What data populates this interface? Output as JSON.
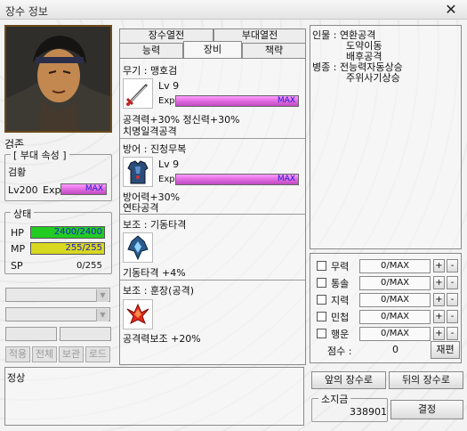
{
  "window": {
    "title": "장수 정보",
    "close_glyph": "✕"
  },
  "general": {
    "name": "검존",
    "unit_attr_title": "[ 부대 속성 ]",
    "unit_attr_value": "검황",
    "level_text": "Lv200",
    "exp_label": "Exp",
    "exp_max": "MAX",
    "exp_fraction": 1.0
  },
  "status": {
    "title": "상태",
    "hp": {
      "label": "HP",
      "value": "2400/2400",
      "fraction": 1.0,
      "color": "#22cc22"
    },
    "mp": {
      "label": "MP",
      "value": "255/255",
      "fraction": 1.0,
      "color": "#d8d820"
    },
    "sp": {
      "label": "SP",
      "value": "0/255",
      "fraction": 0.0,
      "color": "#888888"
    }
  },
  "left_buttons": [
    "적용",
    "전체",
    "보관",
    "로드"
  ],
  "top_tabs": [
    "장수열전",
    "부대열전"
  ],
  "sub_tabs": [
    "능력",
    "장비",
    "책략"
  ],
  "active_sub_tab": "장비",
  "equipment": {
    "weapon": {
      "header": "무기 : 맹호검",
      "level": "Lv 9",
      "exp_label": "Exp",
      "exp_max": "MAX",
      "exp_fraction": 1.0,
      "effect1": "공격력+30% 정신력+30%",
      "effect2": "치명일격공격"
    },
    "armor": {
      "header": "방어 : 진청무복",
      "level": "Lv 9",
      "exp_label": "Exp",
      "exp_max": "MAX",
      "exp_fraction": 1.0,
      "effect1": "방어력+30%",
      "effect2": "연타공격"
    },
    "aux1": {
      "header": "보조 : 기동타격",
      "effect1": "기동타격 +4%"
    },
    "aux2": {
      "header": "보조 : 훈장(공격)",
      "effect1": "공격력보조 +20%"
    }
  },
  "bio": {
    "lines": [
      "인물 : 연환공격",
      "도약이동",
      "배후공격",
      "병종 : 전능력자동상승",
      "주위사기상승"
    ]
  },
  "stats": {
    "rows": [
      {
        "label": "무력",
        "value": "0/MAX"
      },
      {
        "label": "통솔",
        "value": "0/MAX"
      },
      {
        "label": "지력",
        "value": "0/MAX"
      },
      {
        "label": "민첩",
        "value": "0/MAX"
      },
      {
        "label": "행운",
        "value": "0/MAX"
      }
    ],
    "plus": "+",
    "minus": "-",
    "points_label": "점수 :",
    "points_value": "0",
    "reroll_label": "재편"
  },
  "bottom": {
    "message": "정상",
    "prev_button": "앞의 장수로",
    "next_button": "뒤의 장수로",
    "gold_label": "소지금",
    "gold_value": "338901",
    "confirm_button": "결정"
  }
}
